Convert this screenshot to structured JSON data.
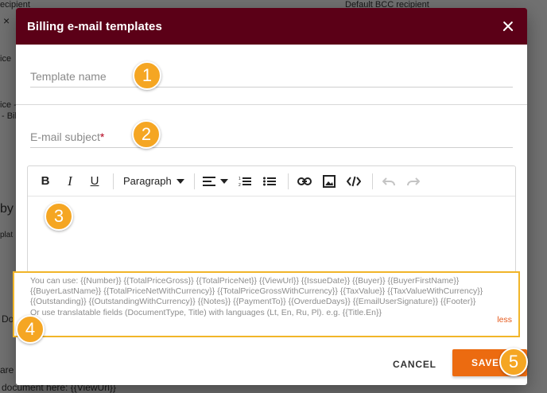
{
  "background": {
    "top_left_fragment": "ecipient",
    "top_right_fragment": "Default BCC recipient",
    "tab_close": "×",
    "left_fragments": [
      "ice",
      "ice -",
      "- Bill",
      "by",
      "plat",
      "Do",
      "are",
      "document here: {{ViewUrl}}"
    ]
  },
  "dialog": {
    "title": "Billing e-mail templates",
    "template_name_label": "Template name",
    "subject_label": "E-mail subject",
    "required_mark": "*",
    "toolbar": {
      "bold": "B",
      "italic": "I",
      "underline": "U",
      "paragraph": "Paragraph"
    },
    "hint_lines": [
      "You can use: {{Number}} {{TotalPriceGross}} {{TotalPriceNet}} {{ViewUrl}} {{IssueDate}} {{Buyer}} {{BuyerFirstName}}",
      "{{BuyerLastName}} {{TotalPriceNetWithCurrency}} {{TotalPriceGrossWithCurrency}} {{TaxValue}} {{TaxValueWithCurrency}}",
      "{{Outstanding}} {{OutstandingWithCurrency}} {{Notes}} {{PaymentTo}} {{OverdueDays}} {{EmailUserSignature}} {{Footer}}",
      "Or use translatable fields (DocumentType, Title) with languages (Lt, En, Ru, Pl). e.g. {{Title.En}}"
    ],
    "less_label": "less",
    "cancel_label": "CANCEL",
    "save_label": "SAVE"
  },
  "badges": [
    "1",
    "2",
    "3",
    "4",
    "5"
  ],
  "colors": {
    "header": "#5b0017",
    "badge": "#f5a623",
    "save_button": "#ec6b10",
    "hint_border": "#f1b529",
    "less_link": "#e5581a",
    "required": "#b3001b"
  }
}
